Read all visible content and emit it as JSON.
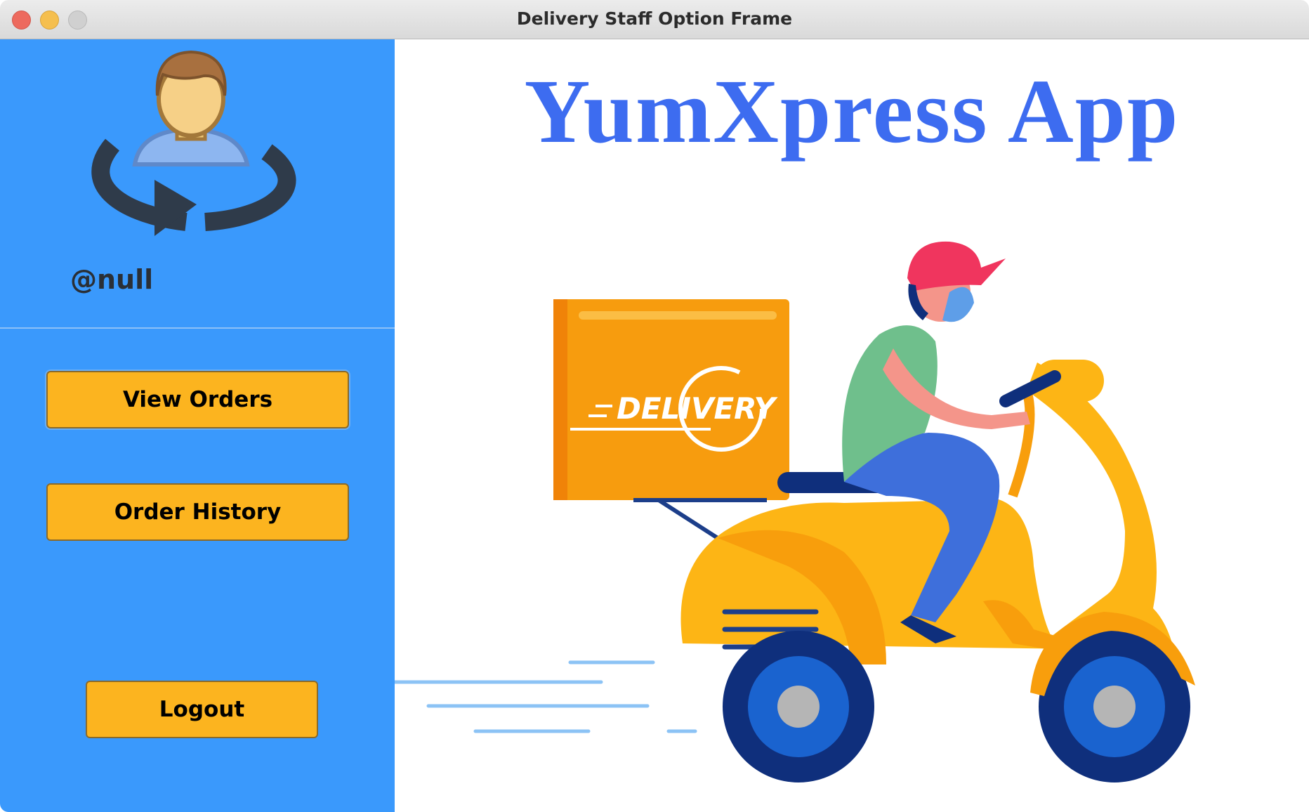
{
  "window": {
    "title": "Delivery Staff Option Frame"
  },
  "sidebar": {
    "username": "@null",
    "buttons": {
      "view_orders": "View Orders",
      "order_history": "Order History",
      "logout": "Logout"
    }
  },
  "main": {
    "app_title": "YumXpress App",
    "illustration": {
      "box_label": "DELIVERY"
    }
  },
  "colors": {
    "sidebar_bg": "#3a99fc",
    "button_bg": "#fcb41f",
    "title_color": "#3d6cf0",
    "scooter": "#fdb515"
  }
}
